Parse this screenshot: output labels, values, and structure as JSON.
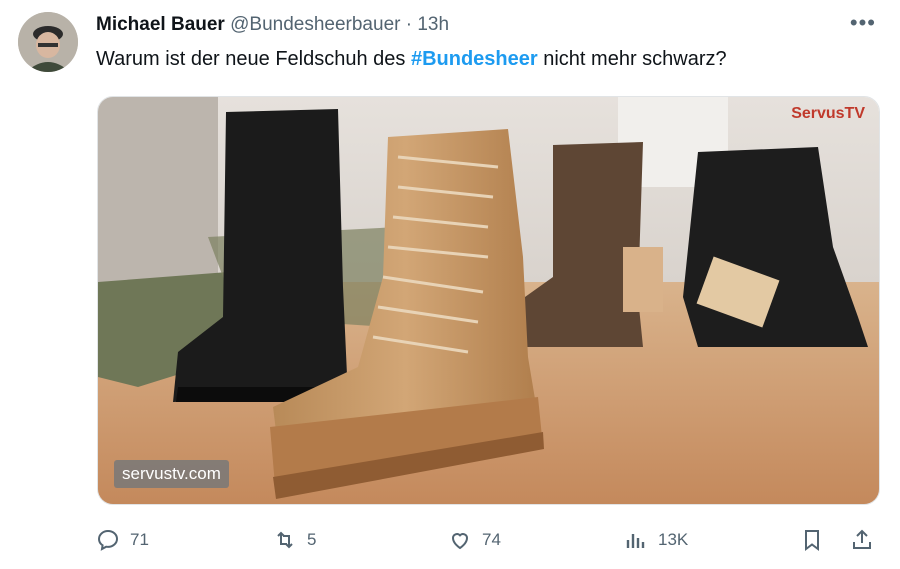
{
  "tweet": {
    "author_name": "Michael Bauer",
    "handle": "@Bundesheerbauer",
    "separator": "·",
    "time": "13h",
    "more": "•••",
    "text_before": "Warum ist der neue Feldschuh des ",
    "hashtag": "#Bundesheer",
    "text_after": " nicht mehr schwarz?",
    "media": {
      "watermark": "servustv.com",
      "logo": "ServusTV"
    }
  },
  "actions": {
    "replies": "71",
    "reposts": "5",
    "likes": "74",
    "views": "13K"
  },
  "colors": {
    "accent": "#1d9bf0",
    "secondary_text": "#536471"
  },
  "icons": [
    "reply-icon",
    "repost-icon",
    "like-icon",
    "views-icon",
    "bookmark-icon",
    "share-icon",
    "more-icon"
  ]
}
